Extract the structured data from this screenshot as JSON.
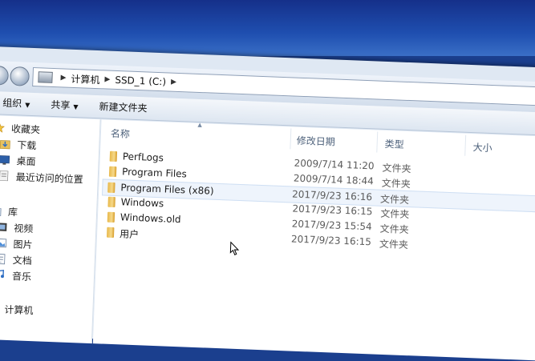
{
  "address": {
    "crumbs": [
      "计算机",
      "SSD_1 (C:)"
    ]
  },
  "toolbar": {
    "organize_label": "组织",
    "share_label": "共享",
    "new_folder_label": "新建文件夹"
  },
  "sidebar": {
    "favorites_label": "收藏夹",
    "favorites": [
      "下载",
      "桌面",
      "最近访问的位置"
    ],
    "libraries_label": "库",
    "libraries": [
      "视频",
      "图片",
      "文档",
      "音乐"
    ],
    "computer_label": "计算机"
  },
  "columns": {
    "name": "名称",
    "modified": "修改日期",
    "type": "类型",
    "size": "大小"
  },
  "files": [
    {
      "name": "PerfLogs",
      "modified": "2009/7/14 11:20",
      "type": "文件夹"
    },
    {
      "name": "Program Files",
      "modified": "2009/7/14 18:44",
      "type": "文件夹"
    },
    {
      "name": "Program Files (x86)",
      "modified": "2017/9/23 16:16",
      "type": "文件夹"
    },
    {
      "name": "Windows",
      "modified": "2017/9/23 16:15",
      "type": "文件夹"
    },
    {
      "name": "Windows.old",
      "modified": "2017/9/23 15:54",
      "type": "文件夹"
    },
    {
      "name": "用户",
      "modified": "2017/9/23 16:15",
      "type": "文件夹"
    }
  ],
  "colors": {
    "desktop": "#1f4fb0",
    "chrome": "#dfe8f3",
    "folder": "#f0c860",
    "hover_row": "#eef4fc"
  }
}
